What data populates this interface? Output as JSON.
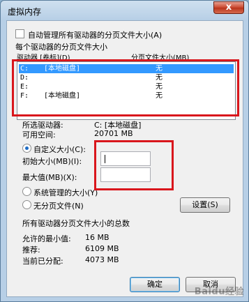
{
  "window": {
    "title": "虚拟内存",
    "close_label": "x"
  },
  "auto_manage": {
    "label": "自动管理所有驱动器的分页文件大小(A)",
    "checked": false
  },
  "group_per_drive": {
    "title": "每个驱动器的分页文件大小",
    "col_drive": "驱动器 [卷标](D)",
    "col_size": "分页文件大小(MB)",
    "drives": [
      {
        "drive": "C:",
        "label": "[本地磁盘]",
        "size": "无",
        "selected": true
      },
      {
        "drive": "D:",
        "label": "",
        "size": "无",
        "selected": false
      },
      {
        "drive": "E:",
        "label": "",
        "size": "无",
        "selected": false
      },
      {
        "drive": "F:",
        "label": "[本地磁盘]",
        "size": "无",
        "selected": false
      }
    ]
  },
  "selected_drive": {
    "label": "所选驱动器:",
    "value": "C:  [本地磁盘]",
    "space_label": "可用空间:",
    "space_value": "20701 MB"
  },
  "options": {
    "custom_label": "自定义大小(C):",
    "initial_label": "初始大小(MB)(I):",
    "initial_value": "",
    "max_label": "最大值(MB)(X):",
    "max_value": "",
    "system_label": "系统管理的大小(Y)",
    "none_label": "无分页文件(N)",
    "set_button": "设置(S)",
    "selected": "custom"
  },
  "totals": {
    "title": "所有驱动器分页文件大小的总数",
    "min_label": "允许的最小值:",
    "min_value": "16 MB",
    "rec_label": "推荐:",
    "rec_value": "6109 MB",
    "cur_label": "当前已分配:",
    "cur_value": "4073 MB"
  },
  "buttons": {
    "ok": "确定",
    "cancel": "取消"
  },
  "watermark": "Baidu经验"
}
